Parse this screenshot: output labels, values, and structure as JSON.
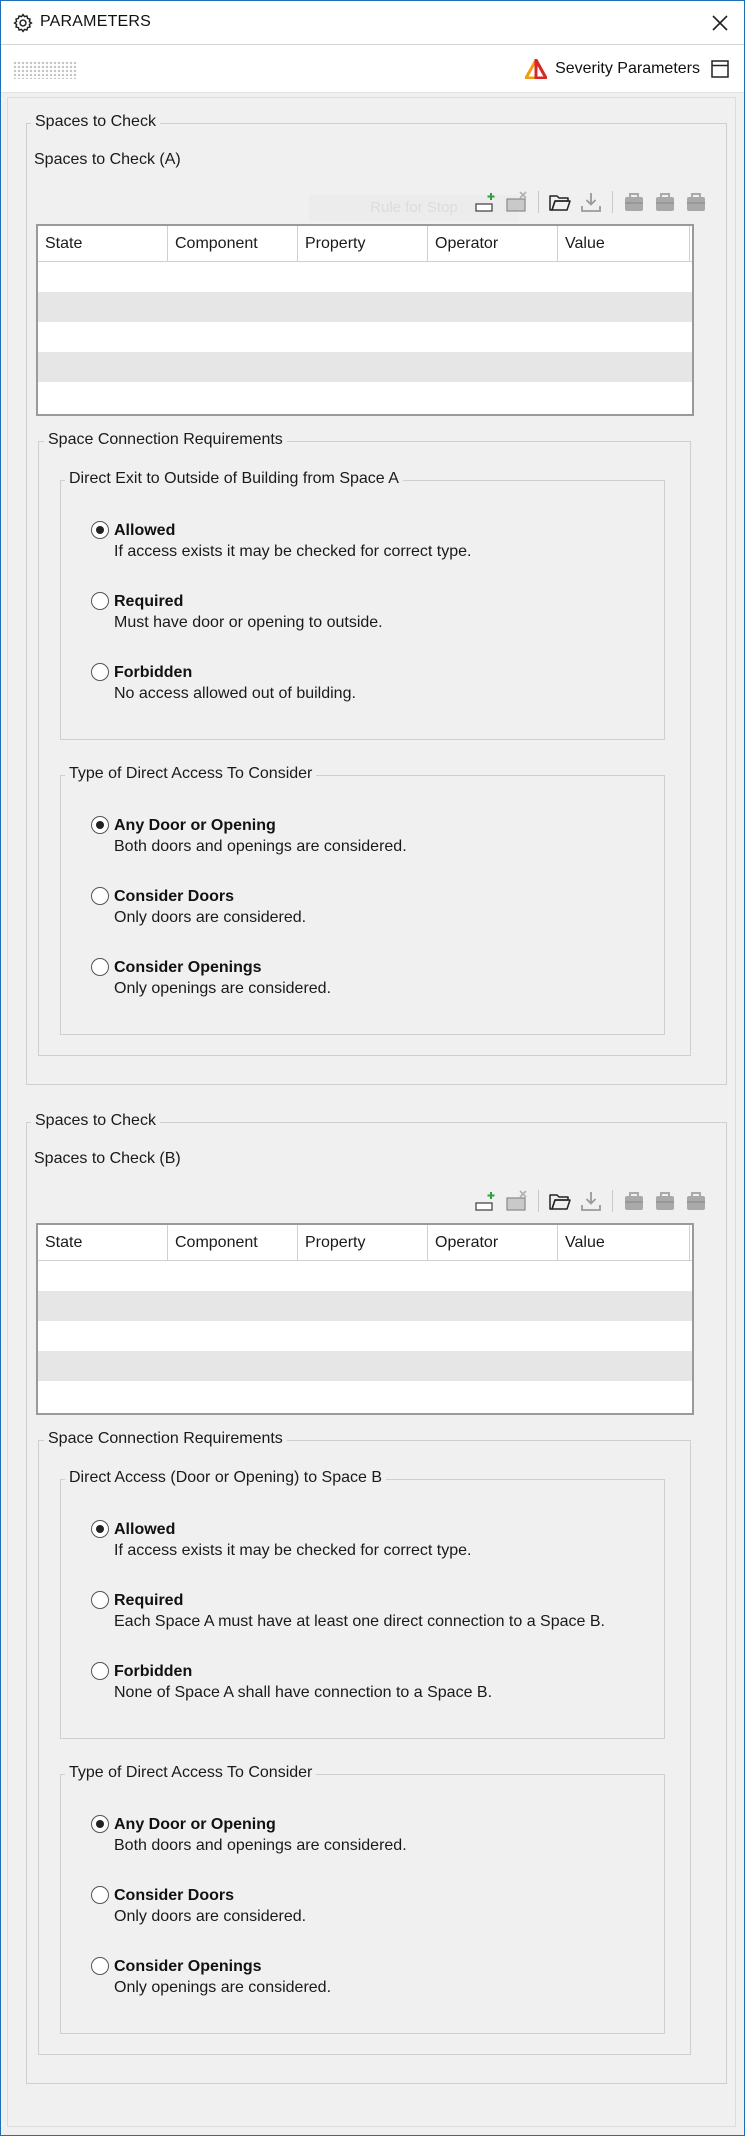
{
  "window": {
    "title": "PARAMETERS"
  },
  "toolbar": {
    "severity_label": "Severity Parameters"
  },
  "colors": {
    "accent": "#1f6fb8",
    "severity_orange": "#f39c12",
    "severity_red": "#d62828",
    "grid_alt_row": "#e6e6e6"
  },
  "icons": [
    "settings-gear-icon",
    "close-icon",
    "grip-icon",
    "severity-triangle-icon",
    "layout-panel-icon",
    "add-row-icon",
    "delete-row-icon",
    "open-folder-icon",
    "download-icon",
    "briefcase-icon"
  ],
  "section_a": {
    "legend": "Spaces to Check",
    "sub_label": "Spaces to Check (A)",
    "watermark": "Rule for Stop",
    "columns": [
      "State",
      "Component",
      "Property",
      "Operator",
      "Value"
    ],
    "connection": {
      "legend": "Space Connection Requirements",
      "exit": {
        "legend": "Direct Exit to Outside of Building from Space A",
        "options": [
          {
            "title": "Allowed",
            "desc": "If access exists it may be checked for correct type.",
            "selected": true
          },
          {
            "title": "Required",
            "desc": "Must have door or opening to outside.",
            "selected": false
          },
          {
            "title": "Forbidden",
            "desc": "No access allowed out of building.",
            "selected": false
          }
        ]
      },
      "access_type": {
        "legend": "Type of Direct Access To Consider",
        "options": [
          {
            "title": "Any Door or Opening",
            "desc": "Both doors and openings are considered.",
            "selected": true
          },
          {
            "title": "Consider Doors",
            "desc": "Only doors are considered.",
            "selected": false
          },
          {
            "title": "Consider Openings",
            "desc": "Only openings are considered.",
            "selected": false
          }
        ]
      }
    }
  },
  "section_b": {
    "legend": "Spaces to Check",
    "sub_label": "Spaces to Check (B)",
    "columns": [
      "State",
      "Component",
      "Property",
      "Operator",
      "Value"
    ],
    "connection": {
      "legend": "Space Connection Requirements",
      "access": {
        "legend": "Direct Access (Door or Opening) to Space B",
        "options": [
          {
            "title": "Allowed",
            "desc": "If access exists it may be checked for correct type.",
            "selected": true
          },
          {
            "title": "Required",
            "desc": "Each Space A must have at least one direct connection to a Space B.",
            "selected": false
          },
          {
            "title": "Forbidden",
            "desc": "None of Space A shall have connection to a Space B.",
            "selected": false
          }
        ]
      },
      "access_type": {
        "legend": "Type of Direct Access To Consider",
        "options": [
          {
            "title": "Any Door or Opening",
            "desc": "Both doors and openings are considered.",
            "selected": true
          },
          {
            "title": "Consider Doors",
            "desc": "Only doors are considered.",
            "selected": false
          },
          {
            "title": "Consider Openings",
            "desc": "Only openings are considered.",
            "selected": false
          }
        ]
      }
    }
  }
}
